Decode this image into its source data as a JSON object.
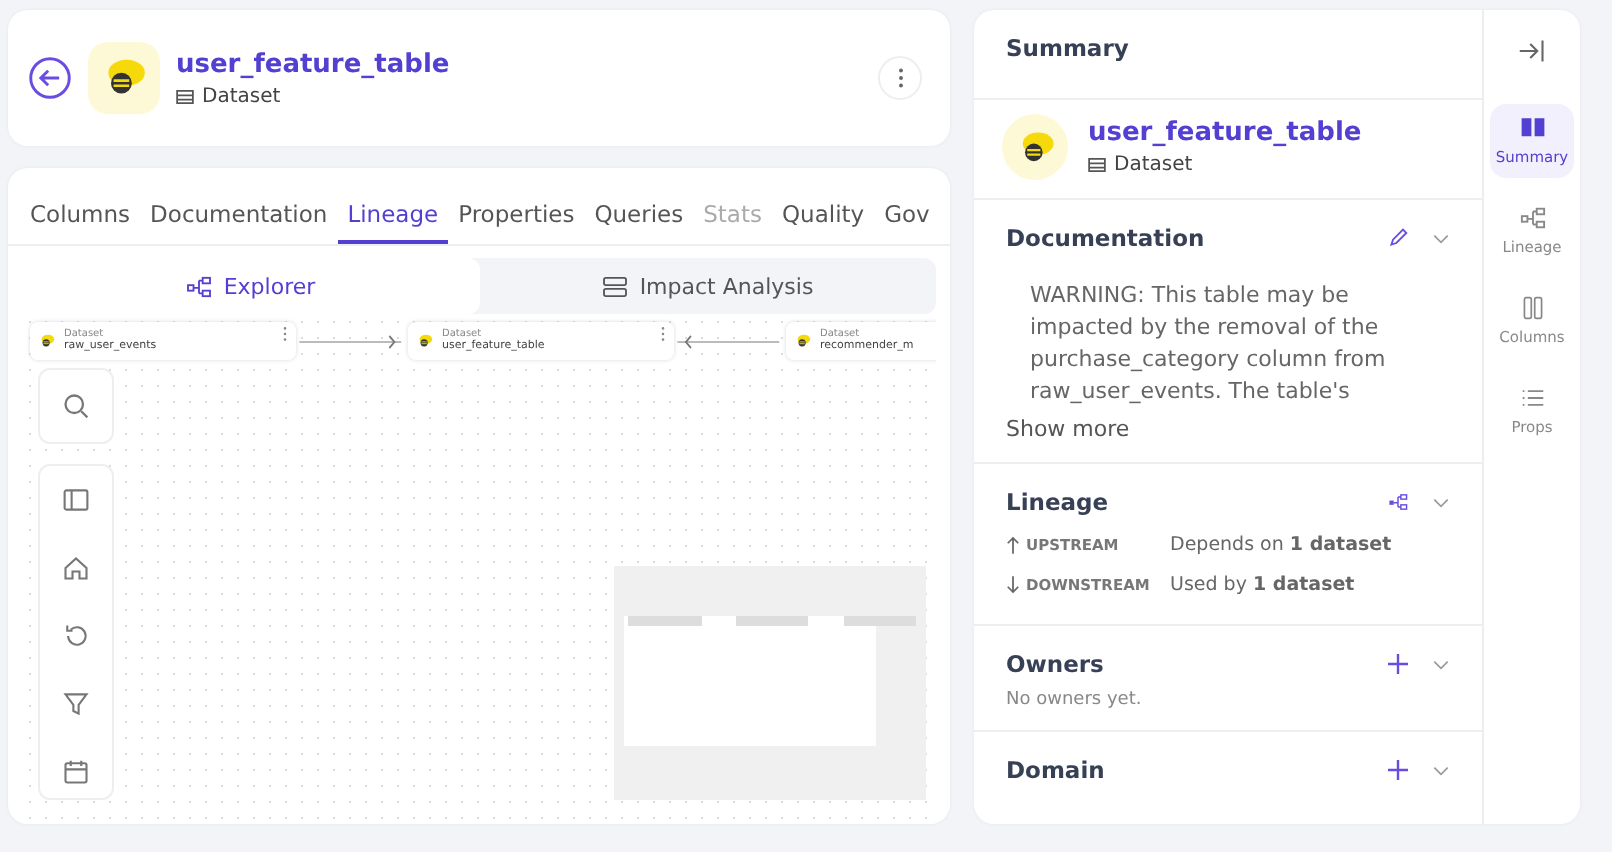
{
  "header": {
    "title": "user_feature_table",
    "type": "Dataset"
  },
  "tabs": [
    {
      "label": "Columns",
      "selected": false,
      "disabled": false
    },
    {
      "label": "Documentation",
      "selected": false,
      "disabled": false
    },
    {
      "label": "Lineage",
      "selected": true,
      "disabled": false
    },
    {
      "label": "Properties",
      "selected": false,
      "disabled": false
    },
    {
      "label": "Queries",
      "selected": false,
      "disabled": false
    },
    {
      "label": "Stats",
      "selected": false,
      "disabled": true
    },
    {
      "label": "Quality",
      "selected": false,
      "disabled": false
    },
    {
      "label": "Gov",
      "selected": false,
      "disabled": false
    }
  ],
  "views": [
    {
      "label": "Explorer",
      "kind": "graph",
      "selected": true
    },
    {
      "label": "Impact Analysis",
      "kind": "table",
      "selected": false
    }
  ],
  "nodes": [
    {
      "type": "Dataset",
      "name": "raw_user_events"
    },
    {
      "type": "Dataset",
      "name": "user_feature_table"
    },
    {
      "type": "Dataset",
      "name": "recommender_m"
    }
  ],
  "summary": {
    "heading": "Summary",
    "title": "user_feature_table",
    "type": "Dataset",
    "documentation": {
      "heading": "Documentation",
      "text": "WARNING: This table may be impacted by the removal of the purchase_category column from raw_user_events. The table's",
      "link": "Show more"
    },
    "lineage": {
      "heading": "Lineage",
      "rows": [
        {
          "kind": "up",
          "label": "UPSTREAM",
          "text": "Depends on **1 dataset**"
        },
        {
          "kind": "down",
          "label": "DOWNSTREAM",
          "text": "Used by **1 dataset**"
        }
      ]
    },
    "owners": {
      "heading": "Owners",
      "empty": "No owners yet."
    },
    "domain": {
      "heading": "Domain"
    }
  },
  "sidenav": [
    {
      "label": "Summary",
      "kind": "book",
      "selected": true
    },
    {
      "label": "Lineage",
      "kind": "lineage",
      "selected": false
    },
    {
      "label": "Columns",
      "kind": "columns",
      "selected": false
    },
    {
      "label": "Props",
      "kind": "list",
      "selected": false
    }
  ]
}
